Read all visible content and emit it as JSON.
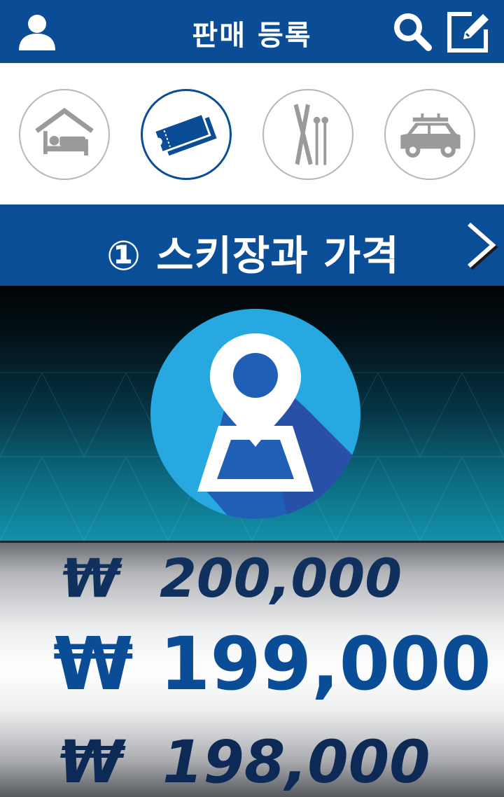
{
  "header": {
    "title": "판매 등록",
    "icons": [
      "user-icon",
      "search-icon",
      "edit-icon"
    ]
  },
  "categories": [
    {
      "name": "lodging",
      "icon": "bed-icon",
      "active": false
    },
    {
      "name": "ticket",
      "icon": "ticket-icon",
      "active": true
    },
    {
      "name": "ski-equipment",
      "icon": "skis-icon",
      "active": false
    },
    {
      "name": "vehicle",
      "icon": "car-icon",
      "active": false
    }
  ],
  "step": {
    "title": "① 스키장과 가격",
    "next_icon": "chevron-right-icon"
  },
  "hero": {
    "icon": "map-pin-icon"
  },
  "prices": {
    "above": {
      "currency": "₩",
      "value": "200,000"
    },
    "selected": {
      "currency": "₩",
      "value": "199,000"
    },
    "below": {
      "currency": "₩",
      "value": "198,000"
    }
  },
  "colors": {
    "primary": "#0a4d96",
    "accent": "#27a8e0",
    "inactive_icon": "#9a9a9a"
  }
}
